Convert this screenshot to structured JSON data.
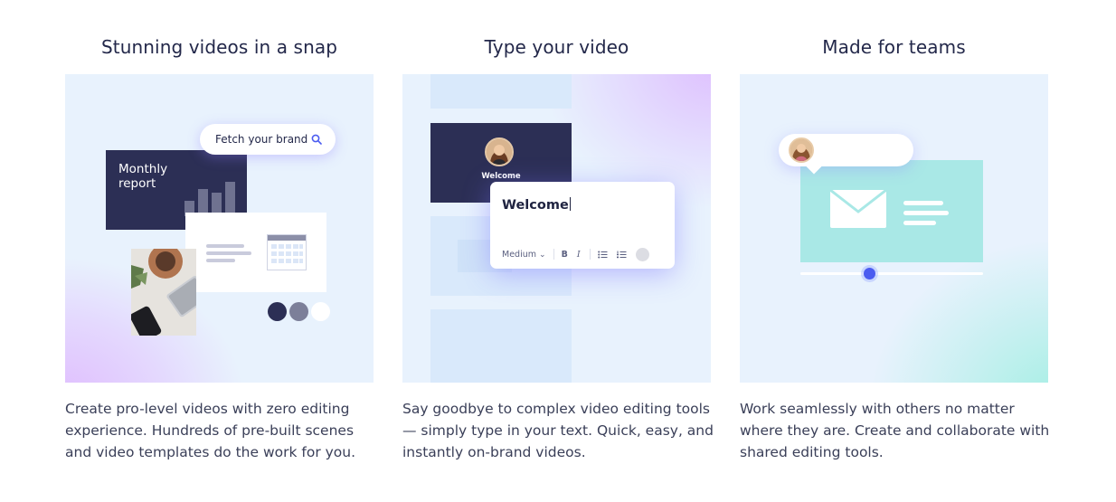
{
  "features": [
    {
      "title": "Stunning videos in a snap",
      "description": "Create pro-level videos with zero editing experience. Hundreds of pre-built scenes and video templates do the work for you.",
      "search_label": "Fetch your brand",
      "card_title": "Monthly report",
      "icons": [
        "search-icon",
        "bar-chart-icon",
        "calendar-icon",
        "photo-thumbnail"
      ],
      "swatches": [
        "#2c2f55",
        "#7c7f99",
        "#ffffff"
      ]
    },
    {
      "title": "Type your video",
      "description": "Say goodbye to complex video editing tools — simply type in your text. Quick, easy, and instantly on-brand videos.",
      "preview_caption": "Welcome",
      "editor_text": "Welcome",
      "toolbar": {
        "size": "Medium",
        "bold": "B",
        "italic": "I"
      },
      "icons": [
        "chevron-down-icon",
        "bold-icon",
        "italic-icon",
        "bullet-list-icon",
        "numbered-list-icon",
        "color-icon"
      ]
    },
    {
      "title": "Made for teams",
      "description": "Work seamlessly with others no matter where they are. Create and collaborate with shared editing tools.",
      "icons": [
        "avatar",
        "envelope-icon"
      ]
    }
  ],
  "colors": {
    "panel_bg": "#e8f2fd",
    "navy": "#2c2f55",
    "accent": "#4b5cf0",
    "teal": "#a9e8e6"
  }
}
